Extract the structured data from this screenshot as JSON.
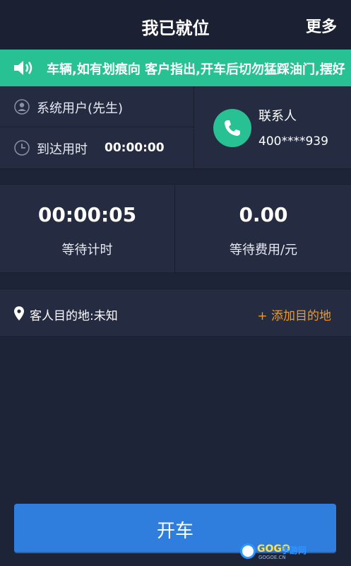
{
  "header": {
    "title": "我已就位",
    "more_label": "更多"
  },
  "notice": {
    "icon": "speaker-icon",
    "text": "车辆,如有划痕向 客户指出,开车后切勿猛踩油门,摆好"
  },
  "customer": {
    "name": "系统用户(先生)",
    "arrival_label": "到达用时",
    "arrival_time": "00:00:00"
  },
  "contact": {
    "label": "联系人",
    "number": "400****939",
    "icon": "phone-icon"
  },
  "timers": {
    "wait_time": "00:00:05",
    "wait_time_label": "等待计时",
    "wait_fee": "0.00",
    "wait_fee_label": "等待费用/元"
  },
  "destination": {
    "label": "客人目的地:未知",
    "add_label": "+ 添加目的地"
  },
  "action": {
    "start_label": "开车"
  },
  "watermark": {
    "brand": "GOGO",
    "brand_cn": "手游网",
    "url": "GOGOE.CN"
  },
  "colors": {
    "accent_green": "#27c193",
    "button_blue": "#2f7ede",
    "add_orange": "#f29a22",
    "background": "#1e2438"
  }
}
